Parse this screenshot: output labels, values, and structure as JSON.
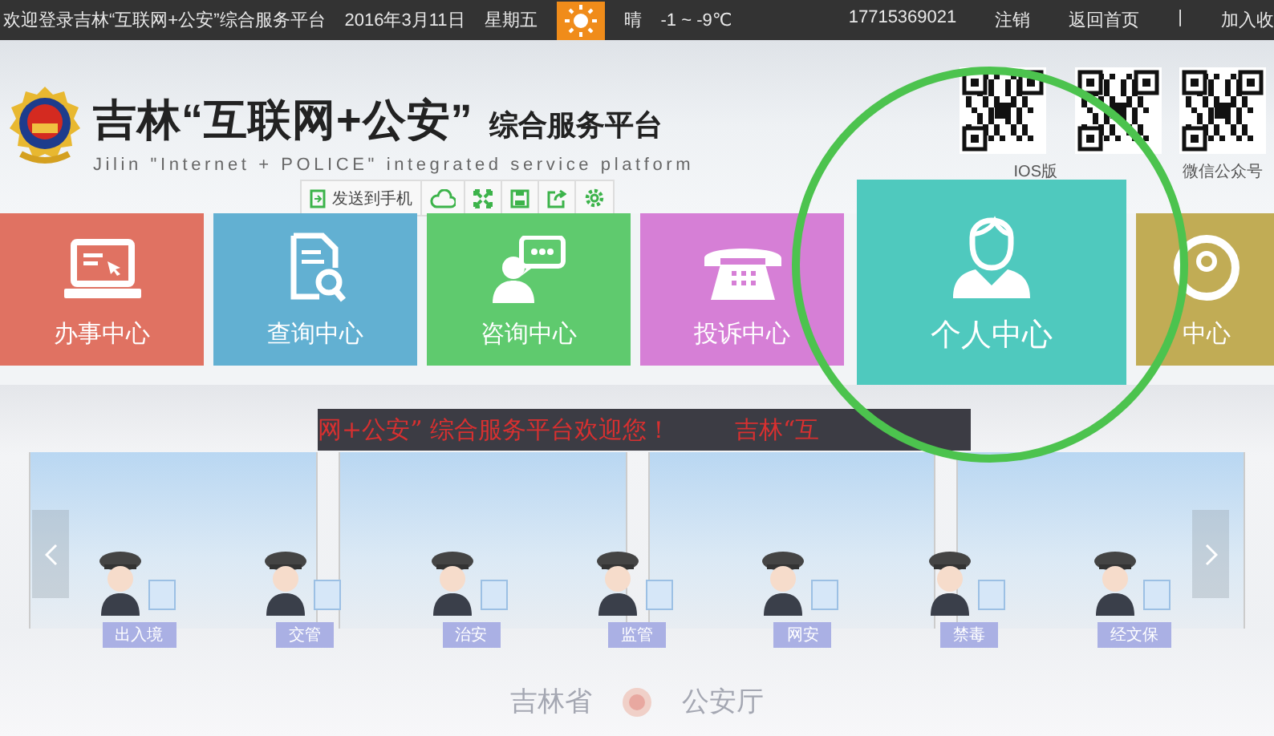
{
  "top_bar": {
    "welcome": "欢迎登录吉林“互联网+公安”综合服务平台",
    "date": "2016年3月11日",
    "weekday": "星期五",
    "weather": "晴",
    "temperature": "-1 ~ -9℃",
    "links": [
      {
        "label": "17715369021"
      },
      {
        "label": "注销"
      },
      {
        "label": "返回首页"
      }
    ],
    "divider": "|",
    "favorite": "加入收"
  },
  "header": {
    "title": "吉林“互联网+公安”",
    "title_suffix": "综合服务平台",
    "subtitle": "Jilin \"Internet + POLICE\" integrated service platform",
    "qr_codes": [
      {
        "kind": "labeled",
        "label": "IOS版"
      },
      {
        "kind": "plain"
      },
      {
        "kind": "labeled",
        "label": "微信公众号"
      }
    ]
  },
  "toolbar": {
    "send_label": "发送到手机"
  },
  "tiles": [
    {
      "label": "办事中心",
      "color": "#e07262",
      "selected": false
    },
    {
      "label": "查询中心",
      "color": "#62b0d2",
      "selected": false
    },
    {
      "label": "咨询中心",
      "color": "#5fca6e",
      "selected": false
    },
    {
      "label": "投诉中心",
      "color": "#d67fd6",
      "selected": false
    },
    {
      "label": "个人中心",
      "color": "#4fc9be",
      "selected": true
    },
    {
      "label": "中心",
      "color": "#c1ac55",
      "selected": false
    }
  ],
  "hall": {
    "banner": [
      "网+公安” 综合服务平台欢迎您！",
      "吉林“互"
    ],
    "counters": [
      {
        "label": "出入境"
      },
      {
        "label": "交管"
      },
      {
        "label": "治安"
      },
      {
        "label": "监管"
      },
      {
        "label": "网安"
      },
      {
        "label": "禁毒"
      },
      {
        "label": "经文保"
      }
    ],
    "footer": [
      "吉林省",
      "公安厅"
    ]
  }
}
